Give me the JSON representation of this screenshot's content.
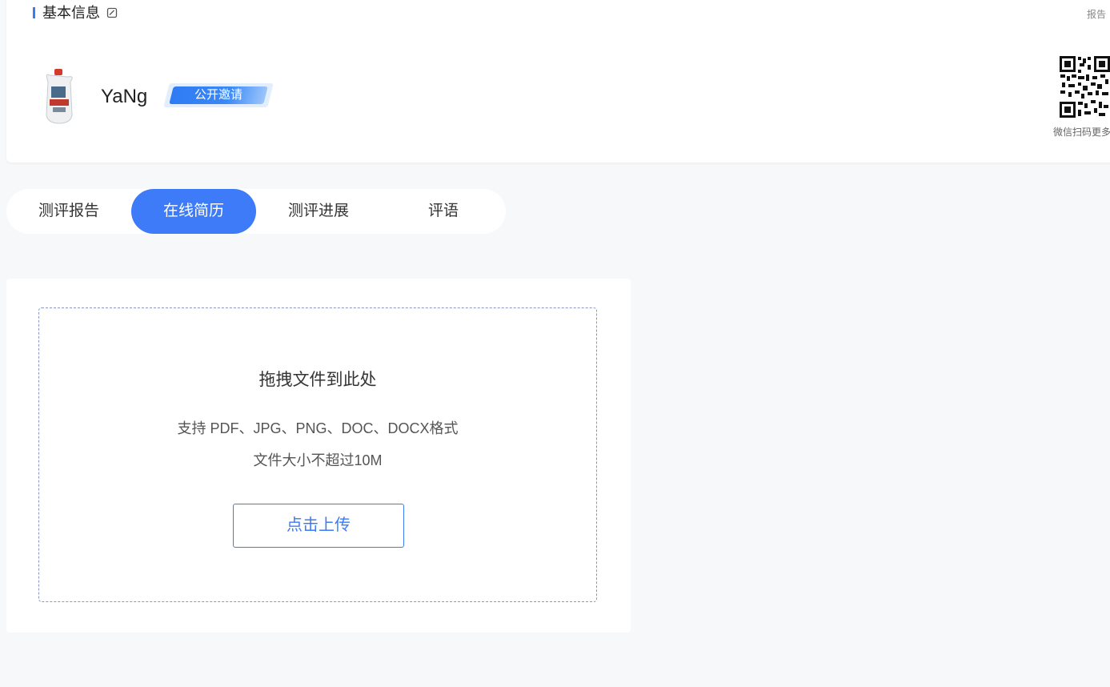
{
  "header": {
    "section_title": "基本信息",
    "report_link": "报告",
    "user_name": "YaNg",
    "invite_badge": "公开邀请",
    "qr_caption": "微信扫码更多"
  },
  "tabs": [
    {
      "label": "测评报告",
      "active": false
    },
    {
      "label": "在线简历",
      "active": true
    },
    {
      "label": "测评进展",
      "active": false
    },
    {
      "label": "评语",
      "active": false
    }
  ],
  "upload": {
    "drop_title": "拖拽文件到此处",
    "formats": "支持 PDF、JPG、PNG、DOC、DOCX格式",
    "size_limit": "文件大小不超过10M",
    "button_label": "点击上传"
  },
  "colors": {
    "accent": "#3c7af7",
    "background": "#f7f8fa",
    "dashed_border": "#8a96c8"
  }
}
